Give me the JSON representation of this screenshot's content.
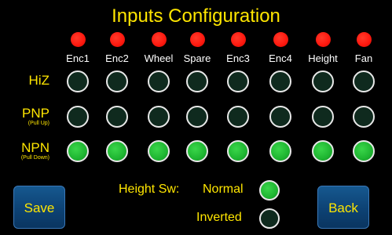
{
  "title": "Inputs Configuration",
  "columns": [
    {
      "label": "Enc1",
      "led": "red"
    },
    {
      "label": "Enc2",
      "led": "red"
    },
    {
      "label": "Wheel",
      "led": "red"
    },
    {
      "label": "Spare",
      "led": "red"
    },
    {
      "label": "Enc3",
      "led": "red"
    },
    {
      "label": "Enc4",
      "led": "red"
    },
    {
      "label": "Height",
      "led": "red"
    },
    {
      "label": "Fan",
      "led": "red"
    }
  ],
  "rows": [
    {
      "label": "HiZ",
      "sublabel": "",
      "selected": [
        false,
        false,
        false,
        false,
        false,
        false,
        false,
        false
      ]
    },
    {
      "label": "PNP",
      "sublabel": "(Pull Up)",
      "selected": [
        false,
        false,
        false,
        false,
        false,
        false,
        false,
        false
      ]
    },
    {
      "label": "NPN",
      "sublabel": "(Pull Down)",
      "selected": [
        true,
        true,
        true,
        true,
        true,
        true,
        true,
        true
      ]
    }
  ],
  "height_switch": {
    "label": "Height Sw:",
    "options": [
      {
        "label": "Normal",
        "selected": true
      },
      {
        "label": "Inverted",
        "selected": false
      }
    ]
  },
  "buttons": {
    "save": "Save",
    "back": "Back"
  },
  "colors": {
    "accent_text": "#ffe600",
    "led_red": "#ff1a10",
    "selected_green": "#1eb531",
    "unselected_fill": "#0f2a1e",
    "button_blue": "#0d4274",
    "background": "#000000"
  }
}
